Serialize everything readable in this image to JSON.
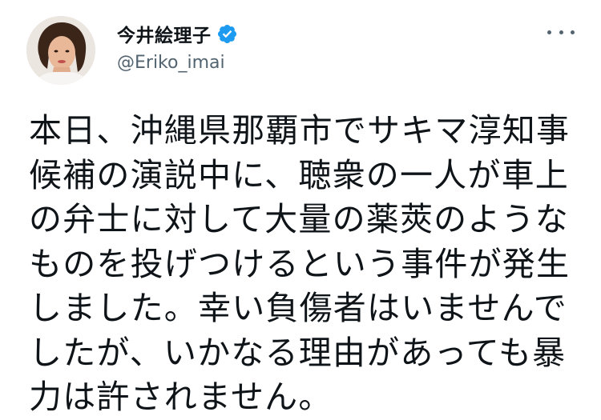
{
  "author": {
    "display_name": "今井絵理子",
    "handle": "@Eriko_imai",
    "verified": true,
    "avatar_icon": "profile-photo"
  },
  "menu": {
    "icon": "more-horizontal-icon"
  },
  "tweet": {
    "lines": [
      "本日、沖縄県那覇市でサキマ淳知事",
      "候補の演説中に、聴衆の一人が車上",
      "の弁士に対して大量の薬莢のような",
      "ものを投げつけるという事件が発生",
      "しました。幸い負傷者はいませんで",
      "したが、いかなる理由があっても暴",
      "力は許されません。"
    ]
  },
  "colors": {
    "text_primary": "#0f1419",
    "text_secondary": "#536471",
    "verified_blue": "#1d9bf0",
    "background": "#ffffff"
  }
}
